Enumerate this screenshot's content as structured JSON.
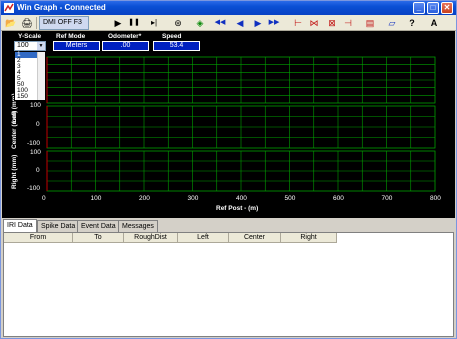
{
  "window": {
    "title": "Win Graph - Connected"
  },
  "titlebar_buttons": {
    "minimize": "_",
    "maximize": "□",
    "close": "✕"
  },
  "toolbar": {
    "open": "📂",
    "print": "🖨",
    "dmi_label": "DMI OFF F3",
    "play": "▶",
    "pause": "❚❚",
    "step": "▸|",
    "target": "⊛",
    "nav": "◈",
    "rewind_fast": "◀◀",
    "rewind": "◀",
    "forward": "▶",
    "forward_fast": "▶▶",
    "marker_left": "⊢",
    "marker_mid": "⋈",
    "marker_box": "⊠",
    "marker_right": "⊣",
    "tool_a": "▤",
    "tool_b": "▱",
    "help": "?",
    "font": "A"
  },
  "header": {
    "yscale_label": "Y-Scale",
    "yscale_value": "100",
    "refmode_label": "Ref Mode",
    "refmode_value": "Meters",
    "odometer_label": "Odometer*",
    "odometer_value": ".00",
    "speed_label": "Speed",
    "speed_value": "53.4"
  },
  "yscale_options": [
    "1",
    "2",
    "3",
    "4",
    "5",
    "50",
    "100",
    "150"
  ],
  "yscale_selected": "1",
  "plots": {
    "left_label": "Left (mm)",
    "center_label": "Center (mm)",
    "right_label": "Right (mm)",
    "center_ticks": [
      "100",
      "0",
      "-100"
    ],
    "right_ticks": [
      "100",
      "0",
      "-100"
    ],
    "x_label": "Ref Post - (m)",
    "x_ticks": [
      "0",
      "100",
      "200",
      "300",
      "400",
      "500",
      "600",
      "700",
      "800"
    ]
  },
  "tabs": [
    "IRI Data",
    "Spike Data",
    "Event Data",
    "Messages"
  ],
  "active_tab": "IRI Data",
  "columns": [
    "From",
    "To",
    "RoughDist",
    "Left",
    "Center",
    "Right"
  ],
  "colors": {
    "background": "#000000",
    "grid": "#00a000",
    "box_fill": "#0020c0",
    "titlebar": "#0a4fd4"
  }
}
